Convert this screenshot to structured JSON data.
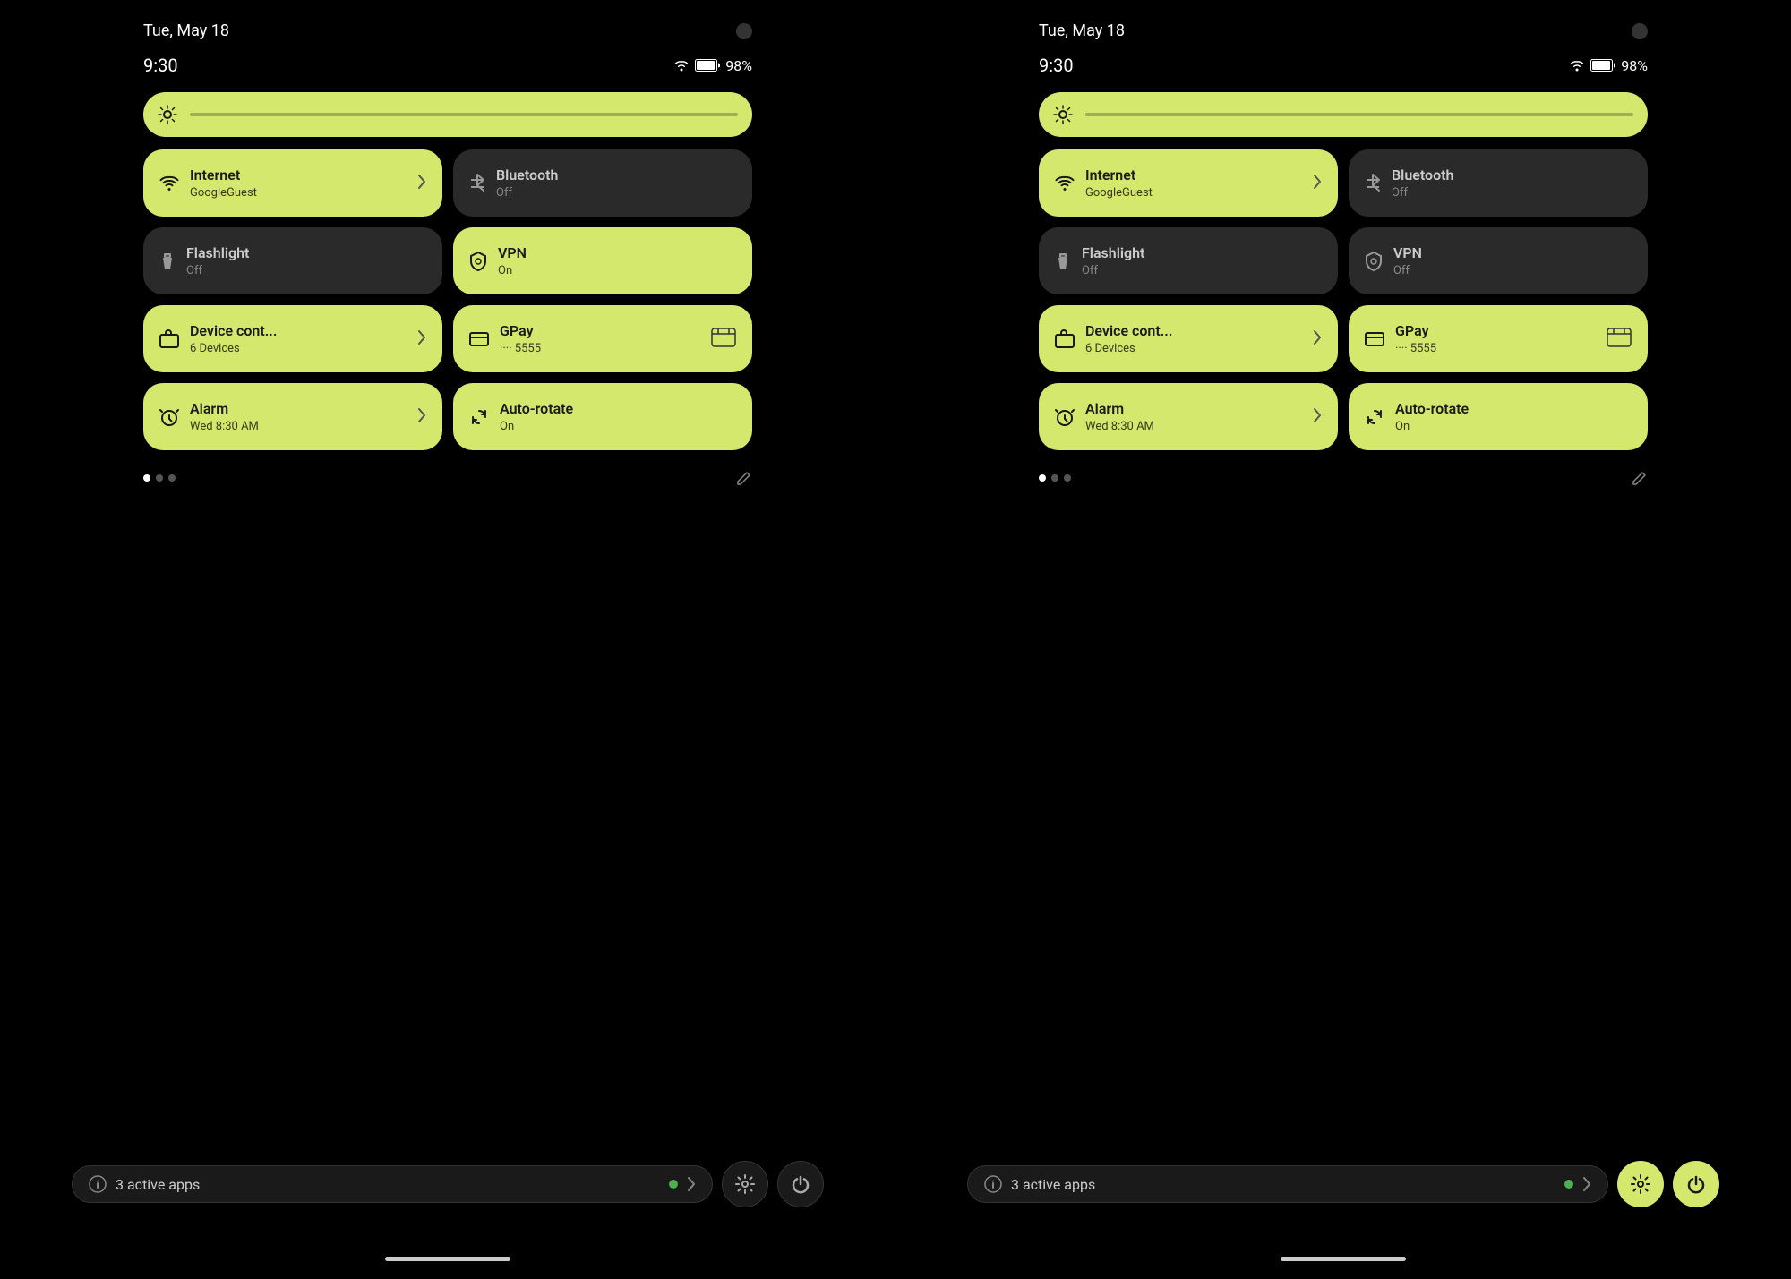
{
  "colors": {
    "active_tile": "#d4e86e",
    "inactive_tile": "#2a2a2a",
    "background": "#000000",
    "text_light": "#ffffff",
    "text_dark": "#1a1a1a",
    "text_muted": "#888888"
  },
  "panels": [
    {
      "id": "left",
      "date": "Tue, May 18",
      "time": "9:30",
      "battery": "98%",
      "tiles": [
        {
          "id": "internet",
          "title": "Internet",
          "subtitle": "GoogleGuest",
          "active": true,
          "icon": "wifi",
          "hasChevron": true
        },
        {
          "id": "bluetooth",
          "title": "Bluetooth",
          "subtitle": "Off",
          "active": false,
          "icon": "bluetooth",
          "hasChevron": false
        },
        {
          "id": "flashlight",
          "title": "Flashlight",
          "subtitle": "Off",
          "active": false,
          "icon": "flashlight",
          "hasChevron": false
        },
        {
          "id": "vpn",
          "title": "VPN",
          "subtitle": "On",
          "active": true,
          "icon": "vpn",
          "hasChevron": false
        },
        {
          "id": "device-control",
          "title": "Device cont...",
          "subtitle": "6 Devices",
          "active": true,
          "icon": "device",
          "hasChevron": true
        },
        {
          "id": "gpay",
          "title": "GPay",
          "subtitle": "···· 5555",
          "active": true,
          "icon": "card",
          "hasChevron": false,
          "hasCard": true
        },
        {
          "id": "alarm",
          "title": "Alarm",
          "subtitle": "Wed 8:30 AM",
          "active": true,
          "icon": "alarm",
          "hasChevron": true
        },
        {
          "id": "auto-rotate",
          "title": "Auto-rotate",
          "subtitle": "On",
          "active": true,
          "icon": "rotate",
          "hasChevron": false
        }
      ],
      "active_apps_label": "3 active apps",
      "settings_active": false,
      "power_active": false
    },
    {
      "id": "right",
      "date": "Tue, May 18",
      "time": "9:30",
      "battery": "98%",
      "tiles": [
        {
          "id": "internet",
          "title": "Internet",
          "subtitle": "GoogleGuest",
          "active": true,
          "icon": "wifi",
          "hasChevron": true
        },
        {
          "id": "bluetooth",
          "title": "Bluetooth",
          "subtitle": "Off",
          "active": false,
          "icon": "bluetooth",
          "hasChevron": false
        },
        {
          "id": "flashlight",
          "title": "Flashlight",
          "subtitle": "Off",
          "active": false,
          "icon": "flashlight",
          "hasChevron": false
        },
        {
          "id": "vpn",
          "title": "VPN",
          "subtitle": "Off",
          "active": false,
          "icon": "vpn",
          "hasChevron": false
        },
        {
          "id": "device-control",
          "title": "Device cont...",
          "subtitle": "6 Devices",
          "active": true,
          "icon": "device",
          "hasChevron": true
        },
        {
          "id": "gpay",
          "title": "GPay",
          "subtitle": "···· 5555",
          "active": true,
          "icon": "card",
          "hasChevron": false,
          "hasCard": true
        },
        {
          "id": "alarm",
          "title": "Alarm",
          "subtitle": "Wed 8:30 AM",
          "active": true,
          "icon": "alarm",
          "hasChevron": true
        },
        {
          "id": "auto-rotate",
          "title": "Auto-rotate",
          "subtitle": "On",
          "active": true,
          "icon": "rotate",
          "hasChevron": false
        }
      ],
      "active_apps_label": "3 active apps",
      "settings_active": true,
      "power_active": true
    }
  ],
  "icons": {
    "wifi": "▾",
    "bluetooth": "✱",
    "flashlight": "🔦",
    "vpn": "🛡",
    "device": "⌂",
    "card": "▬",
    "alarm": "⏰",
    "rotate": "↻",
    "gear": "⚙",
    "power": "⏻",
    "info": "ⓘ",
    "edit": "✎",
    "sun": "⊙"
  }
}
